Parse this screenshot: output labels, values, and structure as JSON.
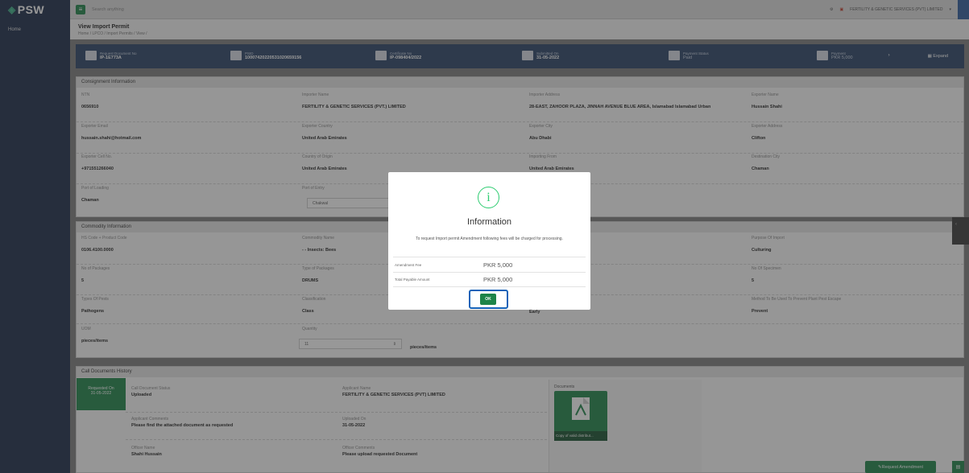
{
  "brand": "PSW",
  "sidebar": {
    "items": [
      {
        "label": "Home"
      }
    ]
  },
  "topbar": {
    "search_placeholder": "Search anything",
    "user_label": "FERTILITY & GENETIC SERVICES (PVT) LIMITED"
  },
  "page": {
    "title": "View Import Permit",
    "breadcrumb": "Home / LPCO / Import Permits / View /"
  },
  "status_strip": {
    "items": [
      {
        "label": "Request Document No",
        "value": "IP-1E773A"
      },
      {
        "label": "PSID",
        "value": "10007420220531020659156"
      },
      {
        "label": "Certificate No",
        "value": "IP-098404/2022"
      },
      {
        "label": "Submitted On",
        "value": "31-05-2022"
      },
      {
        "label": "Payment Status",
        "value": "Paid"
      },
      {
        "label": "Payment",
        "value": "PKR 5,000"
      }
    ],
    "expand_label": "Expand"
  },
  "consignment": {
    "title": "Consignment Information",
    "fields": [
      {
        "label": "NTN",
        "value": "0656910"
      },
      {
        "label": "Importer Name",
        "value": "FERTILITY & GENETIC SERVICES (PVT.) LIMITED"
      },
      {
        "label": "Importer Address",
        "value": "28-EAST, ZAHOOR PLAZA, JINNAH AVENUE BLUE AREA, Islamabad Islamabad Urban"
      },
      {
        "label": "Exporter Name",
        "value": "Hussain Shahi"
      },
      {
        "label": "Exporter Email",
        "value": "hussain.shahi@hotmail.com"
      },
      {
        "label": "Exporter Country",
        "value": "United Arab Emirates"
      },
      {
        "label": "Exporter City",
        "value": "Abu Dhabi"
      },
      {
        "label": "Exporter Address",
        "value": "Clifton"
      },
      {
        "label": "Exporter Cell No.",
        "value": "+971551266040"
      },
      {
        "label": "Country of Origin",
        "value": "United Arab Emirates"
      },
      {
        "label": "Importing From",
        "value": "United Arab Emirates"
      },
      {
        "label": "Destination City",
        "value": "Chaman"
      },
      {
        "label": "Port of Loading",
        "value": "Chaman"
      },
      {
        "label": "Port of Entry",
        "value": ""
      }
    ],
    "port_of_entry_select": "Chakwal"
  },
  "commodity": {
    "title": "Commodity Information",
    "fields": [
      {
        "label": "HS Code + Product Code",
        "value": "0106.4100.0000"
      },
      {
        "label": "Commodity Name",
        "value": "- - Insects: Bees"
      },
      {
        "label": "Purpose Of Import",
        "value": "Culturing"
      },
      {
        "label": "No of Packages",
        "value": "5"
      },
      {
        "label": "Type of Packages",
        "value": "DRUMS"
      },
      {
        "label": "No Of Specimen",
        "value": "5"
      },
      {
        "label": "Types Of Pests",
        "value": "Pathogens"
      },
      {
        "label": "Classification",
        "value": "Class"
      },
      {
        "label": "Early",
        "value": "Early"
      },
      {
        "label": "Method To Be Used To Prevent Plant Pest Escape",
        "value": "Prevent"
      },
      {
        "label": "UOM",
        "value": "pieces/items"
      },
      {
        "label": "Quantity",
        "value": ""
      }
    ],
    "quantity_value": "11",
    "quantity_unit": "pieces/items"
  },
  "call_documents": {
    "title": "Call Documents History",
    "requested_on_label": "Requested On",
    "requested_on_value": "31-05-2022",
    "fields": [
      {
        "label": "Call Document Status",
        "value": "Uploaded"
      },
      {
        "label": "Applicant Name",
        "value": "FERTILITY & GENETIC SERVICES (PVT) LIMITED"
      },
      {
        "label": "Applicant Comments",
        "value": "Please find the attached document as requested"
      },
      {
        "label": "Uploaded On",
        "value": "31-05-2022"
      },
      {
        "label": "Officer Name",
        "value": "Shahi Hussain"
      },
      {
        "label": "Officer Comments",
        "value": "Please upload requested Document"
      }
    ],
    "documents_label": "Documents",
    "document_caption": "Copy of valid distribut..."
  },
  "request_amendment_label": "Request Amendment",
  "modal": {
    "icon": "info-icon",
    "title": "Information",
    "text": "To request Import permit Amendment following fees will be charged for processing.",
    "fees": [
      {
        "label": "Amendment Fee",
        "value": "PKR 5,000"
      },
      {
        "label": "Total Payable Amount",
        "value": "PKR 5,000"
      }
    ],
    "ok_label": "OK"
  },
  "colors": {
    "sidebar": "#1a2b48",
    "accent_green": "#1e8449",
    "strip": "#2b4366",
    "highlight_outline": "#1662b8"
  }
}
